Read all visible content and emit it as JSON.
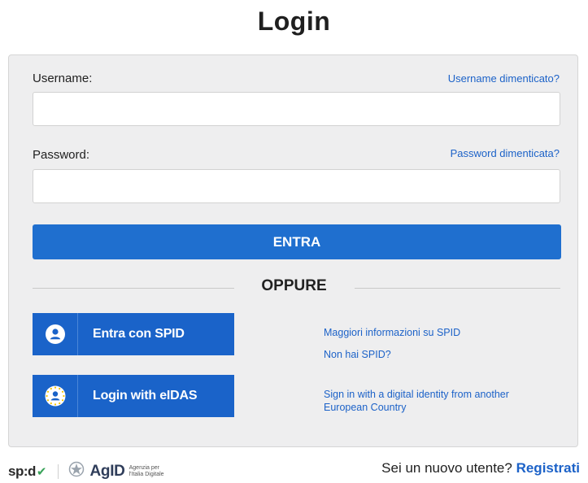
{
  "header": {
    "title": "Login"
  },
  "form": {
    "username_label": "Username:",
    "username_forgot": "Username dimenticato?",
    "username_value": "",
    "password_label": "Password:",
    "password_forgot": "Password dimenticata?",
    "password_value": "",
    "submit_label": "ENTRA"
  },
  "divider": {
    "label": "OPPURE"
  },
  "spid": {
    "button_label": "Entra con SPID",
    "icon": "user-icon",
    "more_info": "Maggiori informazioni su SPID",
    "no_spid": "Non hai SPID?"
  },
  "eidas": {
    "button_label": "Login with eIDAS",
    "icon": "eu-stars-user-icon",
    "info_line1": "Sign in with a digital identity from another",
    "info_line2": "European Country"
  },
  "footer": {
    "spid_logo": "sp:d",
    "agid_logo": "AgID",
    "agid_tagline_1": "Agenzia per",
    "agid_tagline_2": "l'Italia Digitale",
    "new_user_text": "Sei un nuovo utente?",
    "register_label": "Registrati"
  },
  "colors": {
    "primary": "#1f6fcf",
    "link": "#1c62c8",
    "panel_bg": "#eeeeef"
  }
}
